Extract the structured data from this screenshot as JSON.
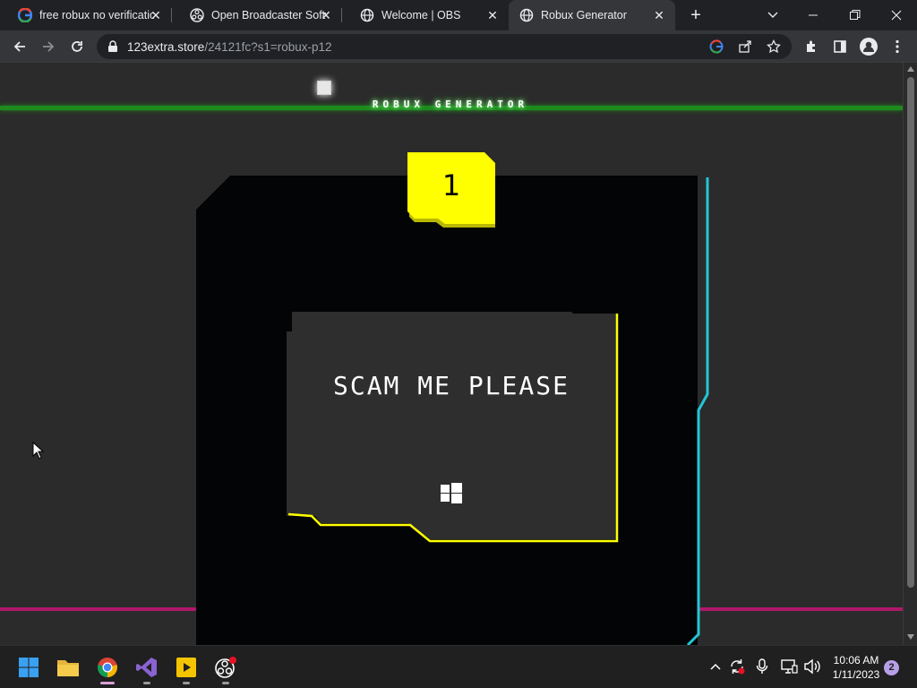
{
  "browser": {
    "tabs": [
      {
        "title": "free robux no verificatio",
        "favicon": "google-icon"
      },
      {
        "title": "Open Broadcaster Softw",
        "favicon": "obs-icon"
      },
      {
        "title": "Welcome | OBS",
        "favicon": "globe-icon"
      },
      {
        "title": "Robux Generator",
        "favicon": "globe-icon",
        "active": true
      }
    ],
    "url_domain": "123extra.store",
    "url_path": "/24121fc?s1=robux-p12"
  },
  "page": {
    "site_title": "ROBUX GENERATOR",
    "step_number": "1",
    "card_text": "SCAM ME PLEASE",
    "colors": {
      "accent_yellow": "#ffff00",
      "accent_cyan": "#22c7d6",
      "green_line": "#1e8a1e",
      "magenta_line": "#b0186a"
    }
  },
  "taskbar": {
    "apps": [
      "start-icon",
      "file-explorer-icon",
      "chrome-icon",
      "visual-studio-icon",
      "media-player-icon",
      "obs-icon"
    ],
    "time": "10:06 AM",
    "date": "1/11/2023",
    "notification_count": "2"
  }
}
